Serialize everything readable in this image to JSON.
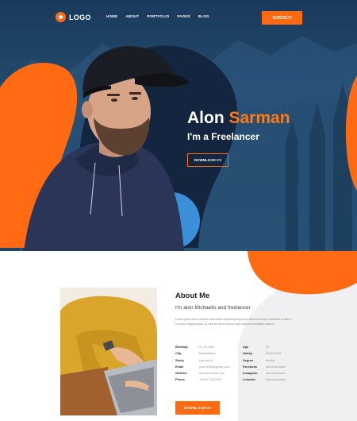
{
  "header": {
    "logo_text": "LOGO",
    "nav": [
      "HOME",
      "ABOUT",
      "PORTFOLIO",
      "PAGES",
      "BLOG"
    ],
    "contact_label": "CONTACT"
  },
  "hero": {
    "first_name": "Alon",
    "last_name": "Sarman",
    "role": "I'm a Freelancer",
    "download_label": "DOWNLOAD CV"
  },
  "about": {
    "title": "About Me",
    "subtitle": "I'm alon Michaelis and freelancer",
    "paragraph": "Lorem ipsum dolor sit amet consectetur adipiscing elit sed do eiusmod tempor incididunt ut labore et dolore magna aliqua. Ut enim ad minim veniam quis nostrud exercitation ullamco.",
    "info": [
      {
        "k": "Birthday",
        "v": "21.08.1992",
        "k2": "Age",
        "v2": "25"
      },
      {
        "k": "City",
        "v": "Bangladesh",
        "k2": "Hobby",
        "v2": "Basket Ball"
      },
      {
        "k": "Study",
        "v": "Harvard U",
        "k2": "Degree",
        "v2": "Master"
      },
      {
        "k": "Email",
        "v": "youremail@gmail.com",
        "k2": "Facebook",
        "v2": "/alonmichaelis"
      },
      {
        "k": "Website",
        "v": "alonmichaelis.com",
        "k2": "Instagram",
        "v2": "/alonmichaelis"
      },
      {
        "k": "Phone",
        "v": "+0120 1234 567",
        "k2": "Linkedin",
        "v2": "/alonmichaelis"
      }
    ],
    "download_label": "DOWNLOAD CV"
  },
  "colors": {
    "accent": "#ff6a13",
    "hero_bg": "#1f4566",
    "blob_dark": "#14263f",
    "blob_blue": "#3a8fd8"
  }
}
